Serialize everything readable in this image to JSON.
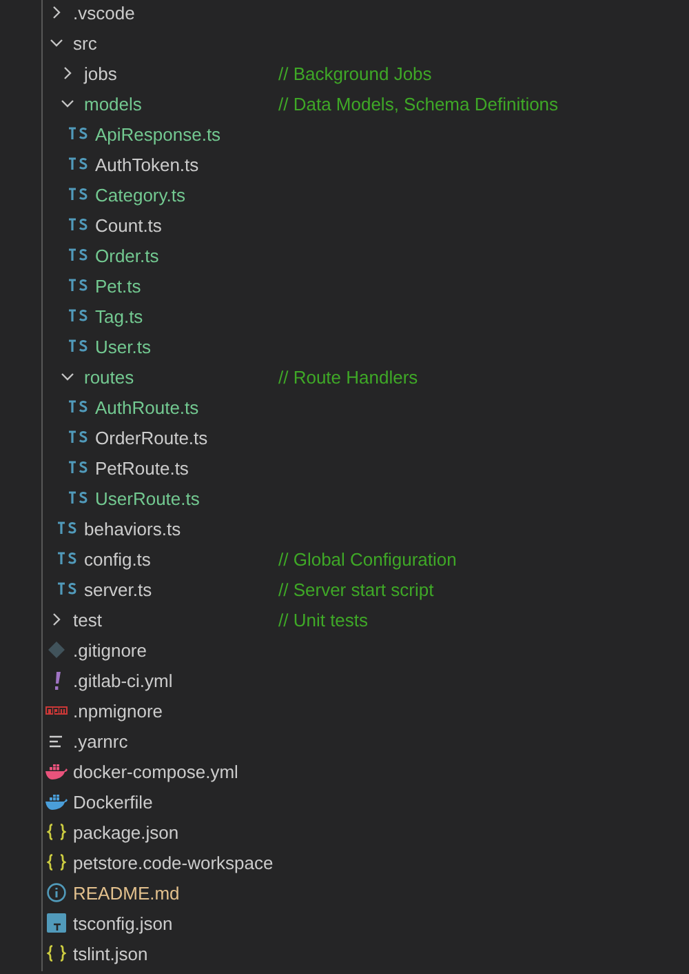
{
  "explorer": {
    "items": [
      {
        "name": ".vscode",
        "kind": "folder",
        "expanded": false,
        "untracked": false,
        "modified": false
      },
      {
        "name": "src",
        "kind": "folder",
        "expanded": true,
        "untracked": false,
        "modified": false,
        "children": [
          {
            "name": "jobs",
            "kind": "folder",
            "expanded": false,
            "untracked": false,
            "modified": false,
            "comment": "// Background Jobs"
          },
          {
            "name": "models",
            "kind": "folder",
            "expanded": true,
            "untracked": true,
            "modified": false,
            "comment": "// Data Models, Schema Definitions",
            "children": [
              {
                "name": "ApiResponse.ts",
                "kind": "ts",
                "untracked": true,
                "modified": false
              },
              {
                "name": "AuthToken.ts",
                "kind": "ts",
                "untracked": false,
                "modified": false
              },
              {
                "name": "Category.ts",
                "kind": "ts",
                "untracked": true,
                "modified": false
              },
              {
                "name": "Count.ts",
                "kind": "ts",
                "untracked": false,
                "modified": false
              },
              {
                "name": "Order.ts",
                "kind": "ts",
                "untracked": true,
                "modified": false
              },
              {
                "name": "Pet.ts",
                "kind": "ts",
                "untracked": true,
                "modified": false
              },
              {
                "name": "Tag.ts",
                "kind": "ts",
                "untracked": true,
                "modified": false
              },
              {
                "name": "User.ts",
                "kind": "ts",
                "untracked": true,
                "modified": false
              }
            ]
          },
          {
            "name": "routes",
            "kind": "folder",
            "expanded": true,
            "untracked": true,
            "modified": false,
            "comment": "// Route Handlers",
            "children": [
              {
                "name": "AuthRoute.ts",
                "kind": "ts",
                "untracked": true,
                "modified": false
              },
              {
                "name": "OrderRoute.ts",
                "kind": "ts",
                "untracked": false,
                "modified": false
              },
              {
                "name": "PetRoute.ts",
                "kind": "ts",
                "untracked": false,
                "modified": false
              },
              {
                "name": "UserRoute.ts",
                "kind": "ts",
                "untracked": true,
                "modified": false
              }
            ]
          },
          {
            "name": "behaviors.ts",
            "kind": "ts",
            "untracked": false,
            "modified": false
          },
          {
            "name": "config.ts",
            "kind": "ts",
            "untracked": false,
            "modified": false,
            "comment": "// Global Configuration"
          },
          {
            "name": "server.ts",
            "kind": "ts",
            "untracked": false,
            "modified": false,
            "comment": "// Server start script"
          }
        ]
      },
      {
        "name": "test",
        "kind": "folder",
        "expanded": false,
        "untracked": false,
        "modified": false,
        "comment": "// Unit tests"
      },
      {
        "name": ".gitignore",
        "kind": "git",
        "untracked": false,
        "modified": false
      },
      {
        "name": ".gitlab-ci.yml",
        "kind": "yaml",
        "untracked": false,
        "modified": false
      },
      {
        "name": ".npmignore",
        "kind": "npm",
        "untracked": false,
        "modified": false
      },
      {
        "name": ".yarnrc",
        "kind": "text",
        "untracked": false,
        "modified": false
      },
      {
        "name": "docker-compose.yml",
        "kind": "compose",
        "untracked": false,
        "modified": false
      },
      {
        "name": "Dockerfile",
        "kind": "docker",
        "untracked": false,
        "modified": false
      },
      {
        "name": "package.json",
        "kind": "json",
        "untracked": false,
        "modified": false
      },
      {
        "name": "petstore.code-workspace",
        "kind": "json",
        "untracked": false,
        "modified": false
      },
      {
        "name": "README.md",
        "kind": "info",
        "untracked": false,
        "modified": true
      },
      {
        "name": "tsconfig.json",
        "kind": "tsconfig",
        "untracked": false,
        "modified": false
      },
      {
        "name": "tslint.json",
        "kind": "json",
        "untracked": false,
        "modified": false
      }
    ]
  }
}
